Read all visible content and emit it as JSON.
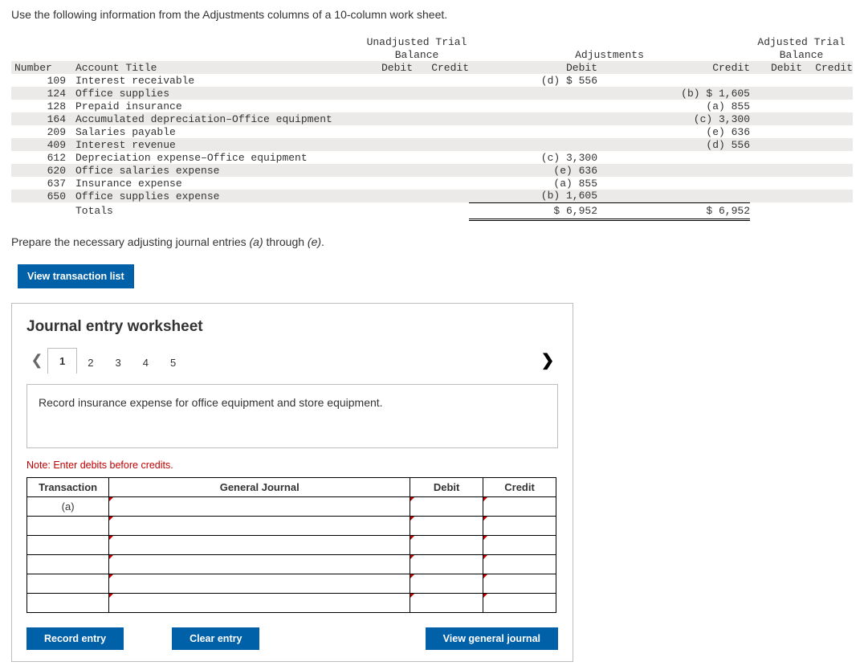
{
  "instructions": "Use the following information from the Adjustments columns of a 10-column work sheet.",
  "ws": {
    "headers": {
      "utb_title": "Unadjusted Trial",
      "utb_sub": "Balance",
      "adj_title": "Adjustments",
      "atb_title": "Adjusted Trial",
      "atb_sub": "Balance",
      "number": "Number",
      "account": "Account Title",
      "debit": "Debit",
      "credit": "Credit"
    },
    "rows": [
      {
        "num": "109",
        "title": "Interest receivable",
        "adj_d": "(d) $ 556",
        "adj_c": ""
      },
      {
        "num": "124",
        "title": "Office supplies",
        "adj_d": "",
        "adj_c": "(b) $ 1,605"
      },
      {
        "num": "128",
        "title": "Prepaid insurance",
        "adj_d": "",
        "adj_c": "(a) 855"
      },
      {
        "num": "164",
        "title": "Accumulated depreciation–Office equipment",
        "adj_d": "",
        "adj_c": "(c) 3,300"
      },
      {
        "num": "209",
        "title": "Salaries payable",
        "adj_d": "",
        "adj_c": "(e) 636"
      },
      {
        "num": "409",
        "title": "Interest revenue",
        "adj_d": "",
        "adj_c": "(d) 556"
      },
      {
        "num": "612",
        "title": "Depreciation expense–Office equipment",
        "adj_d": "(c) 3,300",
        "adj_c": ""
      },
      {
        "num": "620",
        "title": "Office salaries expense",
        "adj_d": "(e) 636",
        "adj_c": ""
      },
      {
        "num": "637",
        "title": "Insurance expense",
        "adj_d": "(a) 855",
        "adj_c": ""
      },
      {
        "num": "650",
        "title": "Office supplies expense",
        "adj_d": "(b) 1,605",
        "adj_c": ""
      }
    ],
    "totals": {
      "label": "Totals",
      "adj_d": "$ 6,952",
      "adj_c": "$ 6,952"
    }
  },
  "instructions2_a": "Prepare the necessary adjusting journal entries ",
  "instructions2_b": "(a)",
  "instructions2_c": " through ",
  "instructions2_d": "(e)",
  "instructions2_e": ".",
  "view_list_btn": "View transaction list",
  "je": {
    "title": "Journal entry worksheet",
    "tabs": [
      "1",
      "2",
      "3",
      "4",
      "5"
    ],
    "desc": "Record insurance expense for office equipment and store equipment.",
    "note": "Note: Enter debits before credits.",
    "cols": {
      "transaction": "Transaction",
      "gj": "General Journal",
      "debit": "Debit",
      "credit": "Credit"
    },
    "first_trans": "(a)",
    "buttons": {
      "record": "Record entry",
      "clear": "Clear entry",
      "view": "View general journal"
    }
  }
}
